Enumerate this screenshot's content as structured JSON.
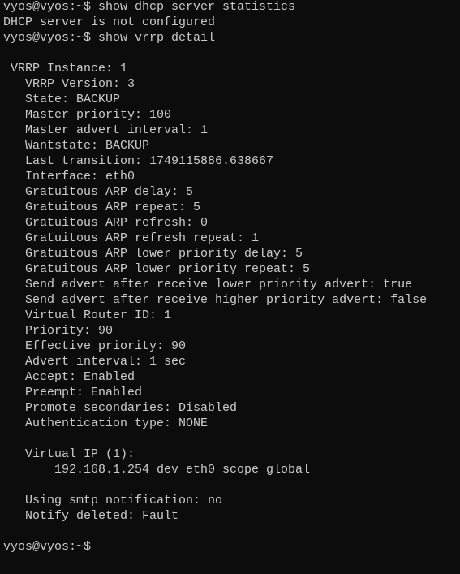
{
  "terminal": {
    "lines": [
      "vyos@vyos:~$ show dhcp server statistics",
      "DHCP server is not configured",
      "vyos@vyos:~$ show vrrp detail",
      "",
      " VRRP Instance: 1",
      "   VRRP Version: 3",
      "   State: BACKUP",
      "   Master priority: 100",
      "   Master advert interval: 1",
      "   Wantstate: BACKUP",
      "   Last transition: 1749115886.638667",
      "   Interface: eth0",
      "   Gratuitous ARP delay: 5",
      "   Gratuitous ARP repeat: 5",
      "   Gratuitous ARP refresh: 0",
      "   Gratuitous ARP refresh repeat: 1",
      "   Gratuitous ARP lower priority delay: 5",
      "   Gratuitous ARP lower priority repeat: 5",
      "   Send advert after receive lower priority advert: true",
      "   Send advert after receive higher priority advert: false",
      "   Virtual Router ID: 1",
      "   Priority: 90",
      "   Effective priority: 90",
      "   Advert interval: 1 sec",
      "   Accept: Enabled",
      "   Preempt: Enabled",
      "   Promote secondaries: Disabled",
      "   Authentication type: NONE",
      "",
      "   Virtual IP (1):",
      "       192.168.1.254 dev eth0 scope global",
      "",
      "   Using smtp notification: no",
      "   Notify deleted: Fault",
      "",
      "vyos@vyos:~$"
    ]
  }
}
